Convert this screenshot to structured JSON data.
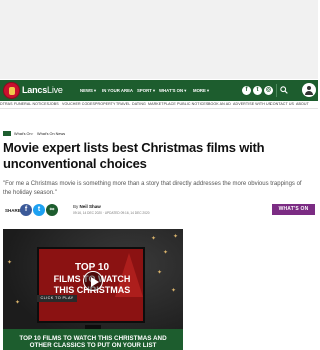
{
  "header": {
    "logo": {
      "brand_bold": "Lancs",
      "brand_light": "Live"
    },
    "nav": [
      {
        "label": "NEWS"
      },
      {
        "label": "IN YOUR AREA"
      },
      {
        "label": "SPORT"
      },
      {
        "label": "WHAT'S ON"
      },
      {
        "label": "MORE"
      }
    ],
    "social_icons": [
      "facebook-icon",
      "twitter-icon",
      "instagram-icon"
    ],
    "search_icon": "search-icon",
    "account_icon": "account-icon"
  },
  "subnav": [
    "DTRAS",
    "FUNERAL NOTICES",
    "JOBS",
    "VOUCHER CODES",
    "PROPERTY",
    "TRAVEL",
    "DATING",
    "MARKETPLACE",
    "PUBLIC NOTICES",
    "BOOK AN AD",
    "ADVERTISE WITH US",
    "CONTACT US",
    "ABOUT"
  ],
  "breadcrumb": {
    "section": "What's On",
    "subsection": "What's On News"
  },
  "article": {
    "headline": "Movie expert lists best Christmas films with unconventional choices",
    "standfirst": "\"For me a Christmas movie is something more than a story that directly addresses the more obvious trappings of the holiday season.\"",
    "share_label": "SHARE",
    "author_prefix": "By",
    "author": "Neil Shaw",
    "published": "09:16, 14 DEC 2020",
    "updated_label": "UPDATED",
    "updated": "09:16, 14 DEC 2020",
    "section_badge": "WHAT'S ON"
  },
  "video": {
    "tv_line1": "TOP 10",
    "tv_line2": "FILMS TO WATCH",
    "tv_line3": "THIS CHRISTMAS",
    "click_to_play": "CLICK TO PLAY",
    "caption": "TOP 10 FILMS TO WATCH THIS CHRISTMAS AND OTHER CLASSICS TO PUT ON YOUR LIST"
  },
  "colors": {
    "brand_green": "#1d5d2e",
    "whats_on_purple": "#7b2c83",
    "logo_red": "#c8102e"
  }
}
